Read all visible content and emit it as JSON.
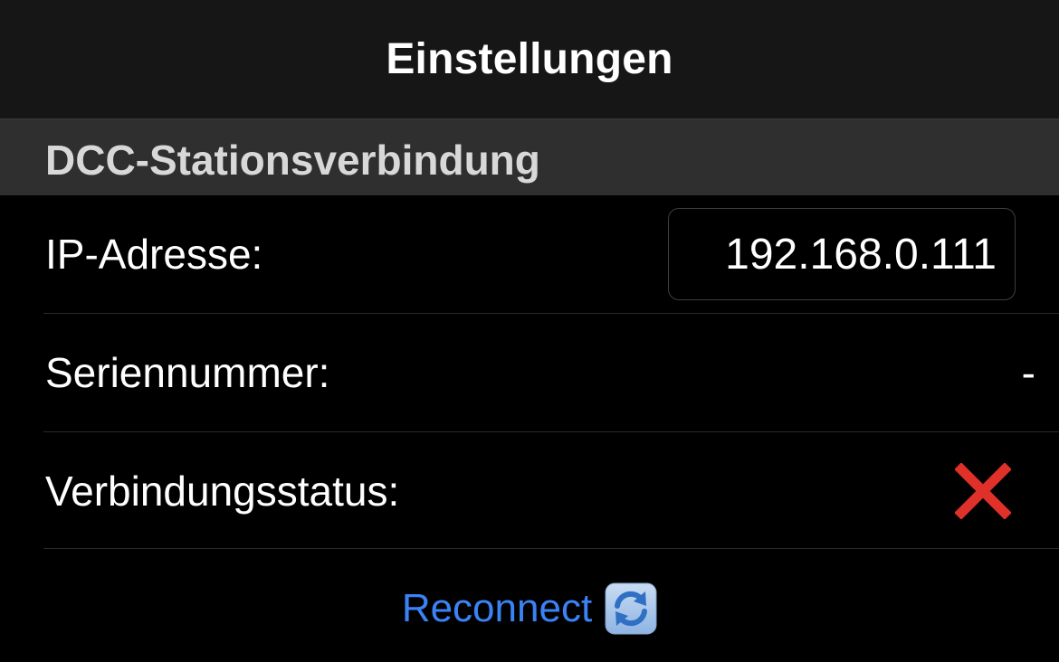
{
  "navbar": {
    "title": "Einstellungen"
  },
  "section": {
    "title": "DCC-Stationsverbindung"
  },
  "rows": {
    "ip": {
      "label": "IP-Adresse:",
      "value": "192.168.0.111"
    },
    "serial": {
      "label": "Seriennummer:",
      "value": "-"
    },
    "status": {
      "label": "Verbindungsstatus:",
      "icon": "red-x-icon",
      "color": "#e0302a"
    }
  },
  "reconnect": {
    "label": "Reconnect",
    "icon": "refresh-icon",
    "color": "#3b82f6"
  }
}
